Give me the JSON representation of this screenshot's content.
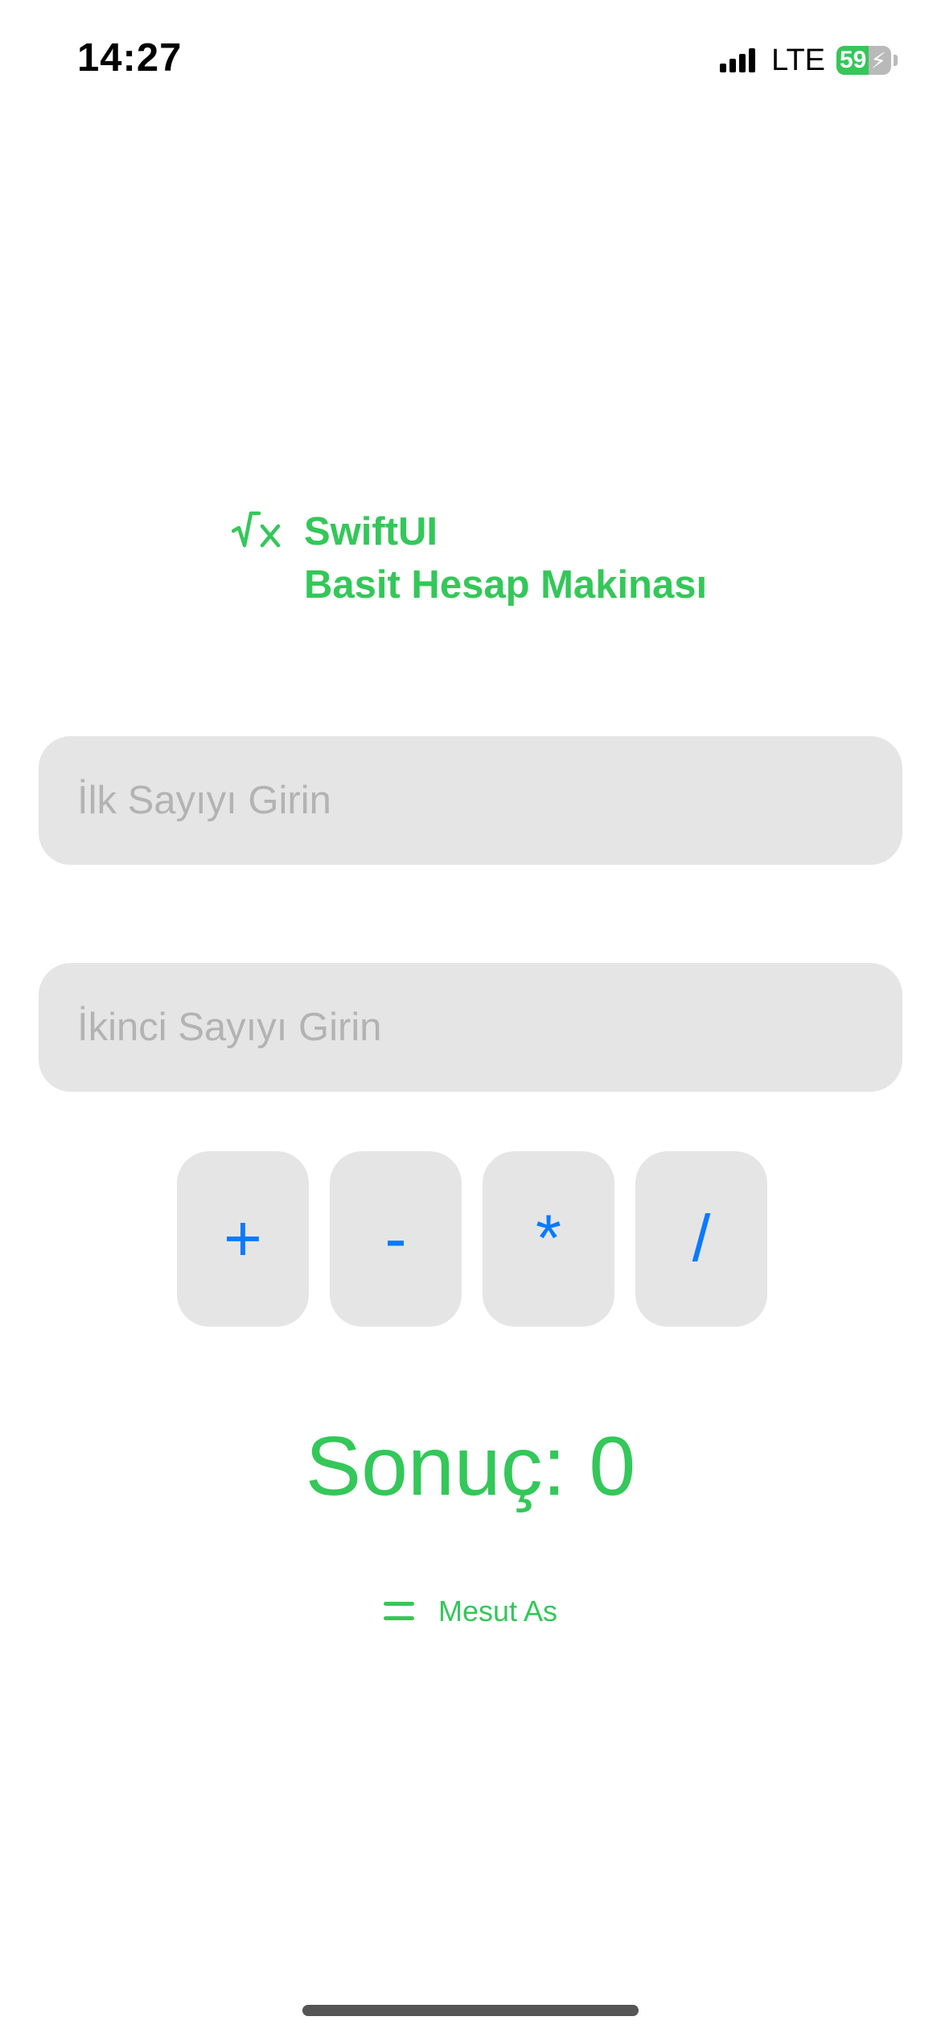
{
  "status_bar": {
    "time": "14:27",
    "network": "LTE",
    "battery_percent": "59",
    "battery_level": 0.59,
    "signal_icon": "cellular-signal-icon",
    "charging_icon": "bolt-icon"
  },
  "header": {
    "icon": "square-root-x-icon",
    "line1": "SwiftUI",
    "line2": "Basit Hesap Makinası"
  },
  "inputs": {
    "first": {
      "placeholder": "İlk Sayıyı Girin",
      "value": ""
    },
    "second": {
      "placeholder": "İkinci Sayıyı Girin",
      "value": ""
    }
  },
  "operators": {
    "add": "+",
    "subtract": "-",
    "multiply": "*",
    "divide": "/"
  },
  "result": {
    "text": "Sonuç: 0"
  },
  "footer": {
    "icon": "equals-icon",
    "author": "Mesut As"
  },
  "colors": {
    "accent_green": "#34c759",
    "button_blue": "#0a7aff",
    "field_background": "#e5e5e5",
    "placeholder_gray": "#b3b3b3"
  }
}
